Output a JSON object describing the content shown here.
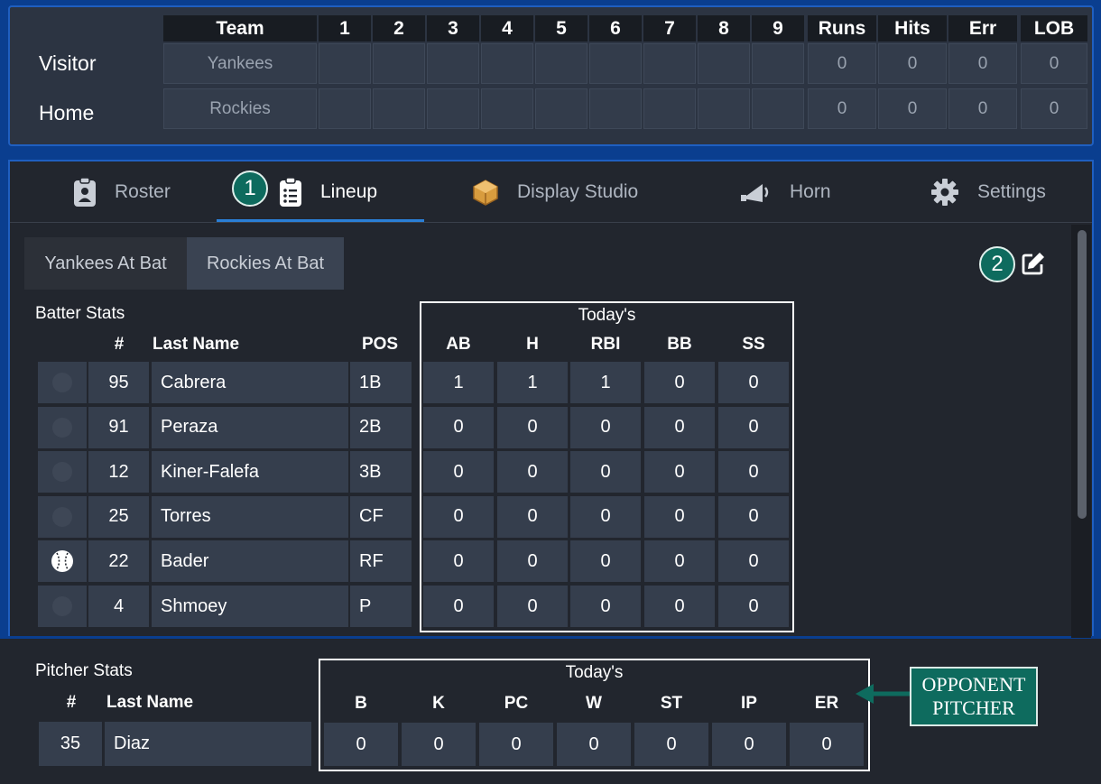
{
  "scoreboard": {
    "headers": [
      "Team",
      "1",
      "2",
      "3",
      "4",
      "5",
      "6",
      "7",
      "8",
      "9",
      "Runs",
      "Hits",
      "Err",
      "LOB"
    ],
    "rows": [
      {
        "label": "Visitor",
        "team": "Yankees",
        "innings": [
          "",
          "",
          "",
          "",
          "",
          "",
          "",
          "",
          ""
        ],
        "runs": "0",
        "hits": "0",
        "err": "0",
        "lob": "0"
      },
      {
        "label": "Home",
        "team": "Rockies",
        "innings": [
          "",
          "",
          "",
          "",
          "",
          "",
          "",
          "",
          ""
        ],
        "runs": "0",
        "hits": "0",
        "err": "0",
        "lob": "0"
      }
    ]
  },
  "tabs": [
    {
      "label": "Roster",
      "icon": "clipboard-user-icon"
    },
    {
      "label": "Lineup",
      "icon": "clipboard-list-icon",
      "active": true
    },
    {
      "label": "Display Studio",
      "icon": "box-icon"
    },
    {
      "label": "Horn",
      "icon": "horn-icon"
    },
    {
      "label": "Settings",
      "icon": "gear-icon"
    }
  ],
  "badges": {
    "one": "1",
    "two": "2"
  },
  "team_toggle": {
    "visitor": "Yankees At Bat",
    "home": "Rockies At Bat"
  },
  "batter_stats": {
    "title": "Batter Stats",
    "headers": {
      "num": "#",
      "last_name": "Last Name",
      "pos": "POS"
    },
    "todays_label": "Today's",
    "stat_headers": [
      "AB",
      "H",
      "RBI",
      "BB",
      "SS"
    ],
    "rows": [
      {
        "at_bat": false,
        "num": "95",
        "name": "Cabrera",
        "pos": "1B",
        "stats": [
          "1",
          "1",
          "1",
          "0",
          "0"
        ]
      },
      {
        "at_bat": false,
        "num": "91",
        "name": "Peraza",
        "pos": "2B",
        "stats": [
          "0",
          "0",
          "0",
          "0",
          "0"
        ]
      },
      {
        "at_bat": false,
        "num": "12",
        "name": "Kiner-Falefa",
        "pos": "3B",
        "stats": [
          "0",
          "0",
          "0",
          "0",
          "0"
        ]
      },
      {
        "at_bat": false,
        "num": "25",
        "name": "Torres",
        "pos": "CF",
        "stats": [
          "0",
          "0",
          "0",
          "0",
          "0"
        ]
      },
      {
        "at_bat": true,
        "num": "22",
        "name": "Bader",
        "pos": "RF",
        "stats": [
          "0",
          "0",
          "0",
          "0",
          "0"
        ]
      },
      {
        "at_bat": false,
        "num": "4",
        "name": "Shmoey",
        "pos": "P",
        "stats": [
          "0",
          "0",
          "0",
          "0",
          "0"
        ]
      }
    ]
  },
  "pitcher_stats": {
    "title": "Pitcher Stats",
    "headers": {
      "num": "#",
      "last_name": "Last Name"
    },
    "todays_label": "Today's",
    "stat_headers": [
      "B",
      "K",
      "PC",
      "W",
      "ST",
      "IP",
      "ER"
    ],
    "row": {
      "num": "35",
      "name": "Diaz",
      "stats": [
        "0",
        "0",
        "0",
        "0",
        "0",
        "0",
        "0"
      ]
    }
  },
  "callout": {
    "line1": "OPPONENT",
    "line2": "PITCHER"
  },
  "colors": {
    "accent": "#2a7fd6",
    "badge": "#0e6b5e",
    "frame": "#1f5fc0"
  }
}
